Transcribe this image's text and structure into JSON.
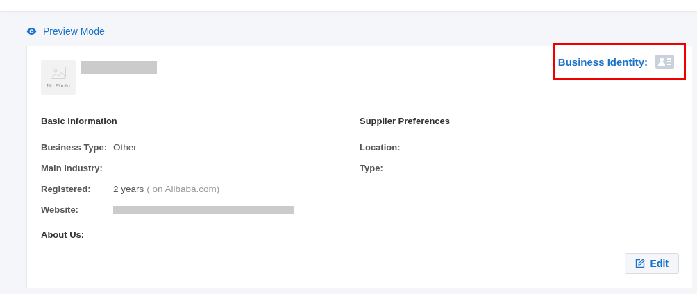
{
  "preview_mode": {
    "label": "Preview Mode"
  },
  "profile": {
    "photo_placeholder": "No Photo",
    "business_identity": {
      "label": "Business Identity:",
      "highlighted": true
    }
  },
  "basic_information": {
    "title": "Basic Information",
    "fields": [
      {
        "label": "Business Type:",
        "value": "Other"
      },
      {
        "label": "Main Industry:"
      },
      {
        "label": "Registered:",
        "value": "2 years",
        "note": "( on Alibaba.com)"
      },
      {
        "label": "Website:",
        "redacted": true
      }
    ]
  },
  "supplier_preferences": {
    "title": "Supplier Preferences",
    "fields": [
      {
        "label": "Location:"
      },
      {
        "label": "Type:"
      }
    ]
  },
  "about_us": {
    "label": "About Us:"
  },
  "edit_button": {
    "label": "Edit"
  }
}
